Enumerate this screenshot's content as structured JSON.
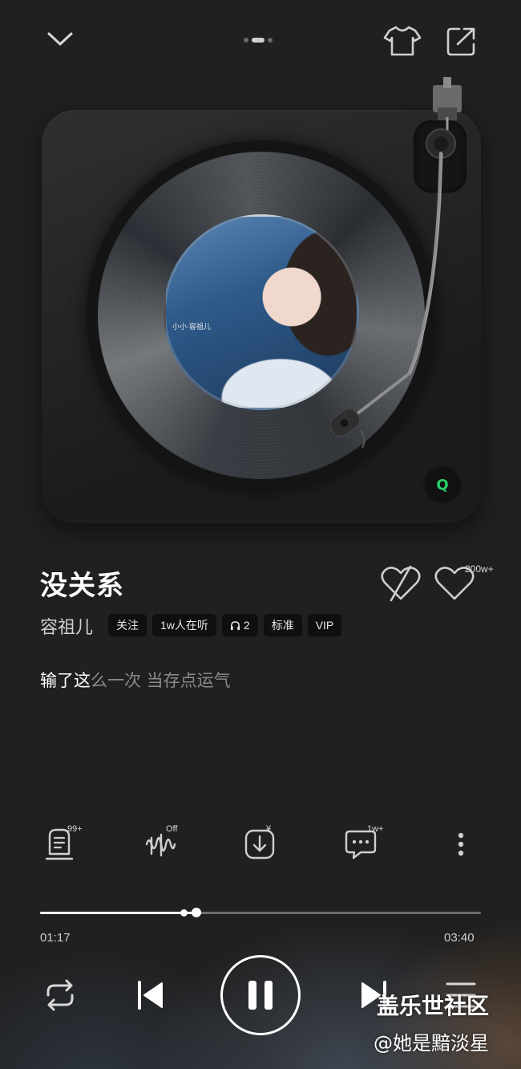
{
  "header": {
    "page_indicator_total": 3,
    "page_indicator_active": 2
  },
  "player": {
    "album_label_text": "小小·容祖儿",
    "quality_badge": "Q"
  },
  "song": {
    "title": "没关系",
    "artist": "容祖儿",
    "tags": {
      "follow": "关注",
      "listeners": "1w人在听",
      "headphones_count": "2",
      "quality": "标准",
      "vip": "VIP"
    },
    "like_count": "200w+",
    "lyric_highlight": "输了这",
    "lyric_rest": "么一次 当存点运气"
  },
  "tools": {
    "playlist_badge": "99+",
    "effect_badge": "Off",
    "download_badge": "¥",
    "comments_badge": "1w+"
  },
  "progress": {
    "current_time": "01:17",
    "total_time": "03:40",
    "played_fraction": 0.35
  },
  "watermark": {
    "line1": "盖乐世社区",
    "line2": "@她是黯淡星"
  },
  "colors": {
    "background": "#202020",
    "accent_green": "#2bd06a"
  }
}
